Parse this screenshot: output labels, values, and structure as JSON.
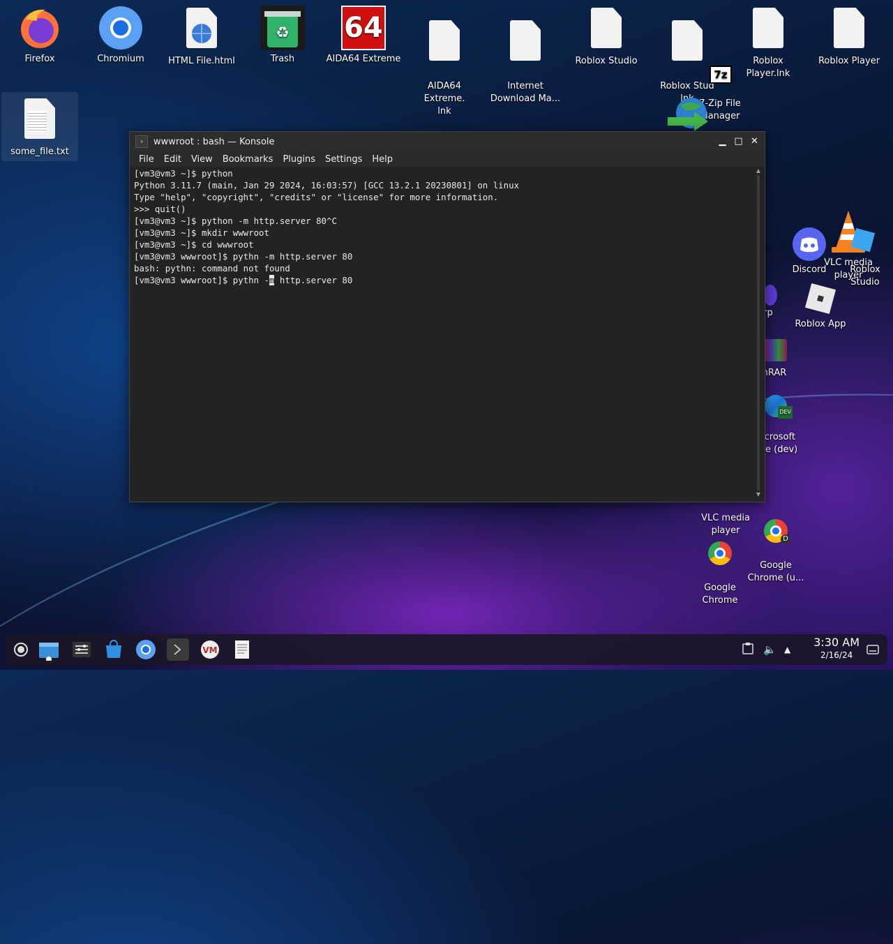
{
  "desktop_icons": [
    {
      "label": "Firefox",
      "icon": "firefox-icon"
    },
    {
      "label": "Chromium",
      "icon": "chromium-icon"
    },
    {
      "label": "HTML File.html",
      "icon": "html-file-icon"
    },
    {
      "label": "Trash",
      "icon": "trash-icon"
    },
    {
      "label": "AIDA64 Extreme",
      "icon": "aida64-icon",
      "glyph_text": "64"
    },
    {
      "label": "AIDA64 Extreme.\nlnk",
      "icon": "file-icon"
    },
    {
      "label": "Internet\nDownload Ma...",
      "icon": "file-icon"
    },
    {
      "label": "Roblox Studio",
      "icon": "file-icon"
    },
    {
      "label": "Roblox Stud\nlnk",
      "icon": "file-icon"
    },
    {
      "label": "Roblox Player.lnk",
      "icon": "file-icon"
    },
    {
      "label": "Roblox Player",
      "icon": "file-icon"
    },
    {
      "label": "some_file.txt",
      "icon": "text-file-icon"
    },
    {
      "label": "7-Zip File\nManager",
      "icon": "7zip-icon",
      "glyph_text": "7z"
    },
    {
      "label": "VLC media\nplayer",
      "icon": "vlc-icon"
    },
    {
      "label": "Roblox\nStudio",
      "icon": "roblox-studio-icon"
    },
    {
      "label": "Discord",
      "icon": "discord-icon"
    },
    {
      "label": "orp",
      "icon": "app-icon"
    },
    {
      "label": "Roblox App",
      "icon": "roblox-icon"
    },
    {
      "label": "/inRAR",
      "icon": "winrar-icon"
    },
    {
      "label": "icrosoft\nge (dev)",
      "icon": "edge-dev-icon",
      "glyph_text": "DEV"
    },
    {
      "label": "VLC media\nplayer",
      "icon": "vlc-icon"
    },
    {
      "label": "Google\nChrome",
      "icon": "chrome-icon"
    },
    {
      "label": "Google\nChrome (u...",
      "icon": "chrome-dev-icon",
      "glyph_text": "D"
    }
  ],
  "window": {
    "title": "wwwroot : bash — Konsole",
    "menu": [
      "File",
      "Edit",
      "View",
      "Bookmarks",
      "Plugins",
      "Settings",
      "Help"
    ]
  },
  "terminal": {
    "lines": [
      "[vm3@vm3 ~]$ python",
      "Python 3.11.7 (main, Jan 29 2024, 16:03:57) [GCC 13.2.1 20230801] on linux",
      "Type \"help\", \"copyright\", \"credits\" or \"license\" for more information.",
      ">>> quit()",
      "[vm3@vm3 ~]$ python -m http.server 80^C",
      "[vm3@vm3 ~]$ mkdir wwwroot",
      "[vm3@vm3 ~]$ cd wwwroot",
      "[vm3@vm3 wwwroot]$ pythn -m http.server 80",
      "bash: pythn: command not found"
    ],
    "current_prompt": "[vm3@vm3 wwwroot]$ pythn -",
    "cursor_char": "m",
    "current_rest": " http.server 80"
  },
  "taskbar": {
    "apps": [
      "app-launcher-icon",
      "file-manager-icon",
      "system-settings-icon",
      "discover-store-icon",
      "chromium-icon",
      "konsole-icon",
      "virt-manager-icon",
      "text-editor-icon"
    ],
    "time": "3:30 AM",
    "date": "2/16/24"
  },
  "colors": {
    "terminal_bg": "#232323",
    "terminal_fg": "#e8e8e8",
    "titlebar": "#2d2d2d"
  }
}
